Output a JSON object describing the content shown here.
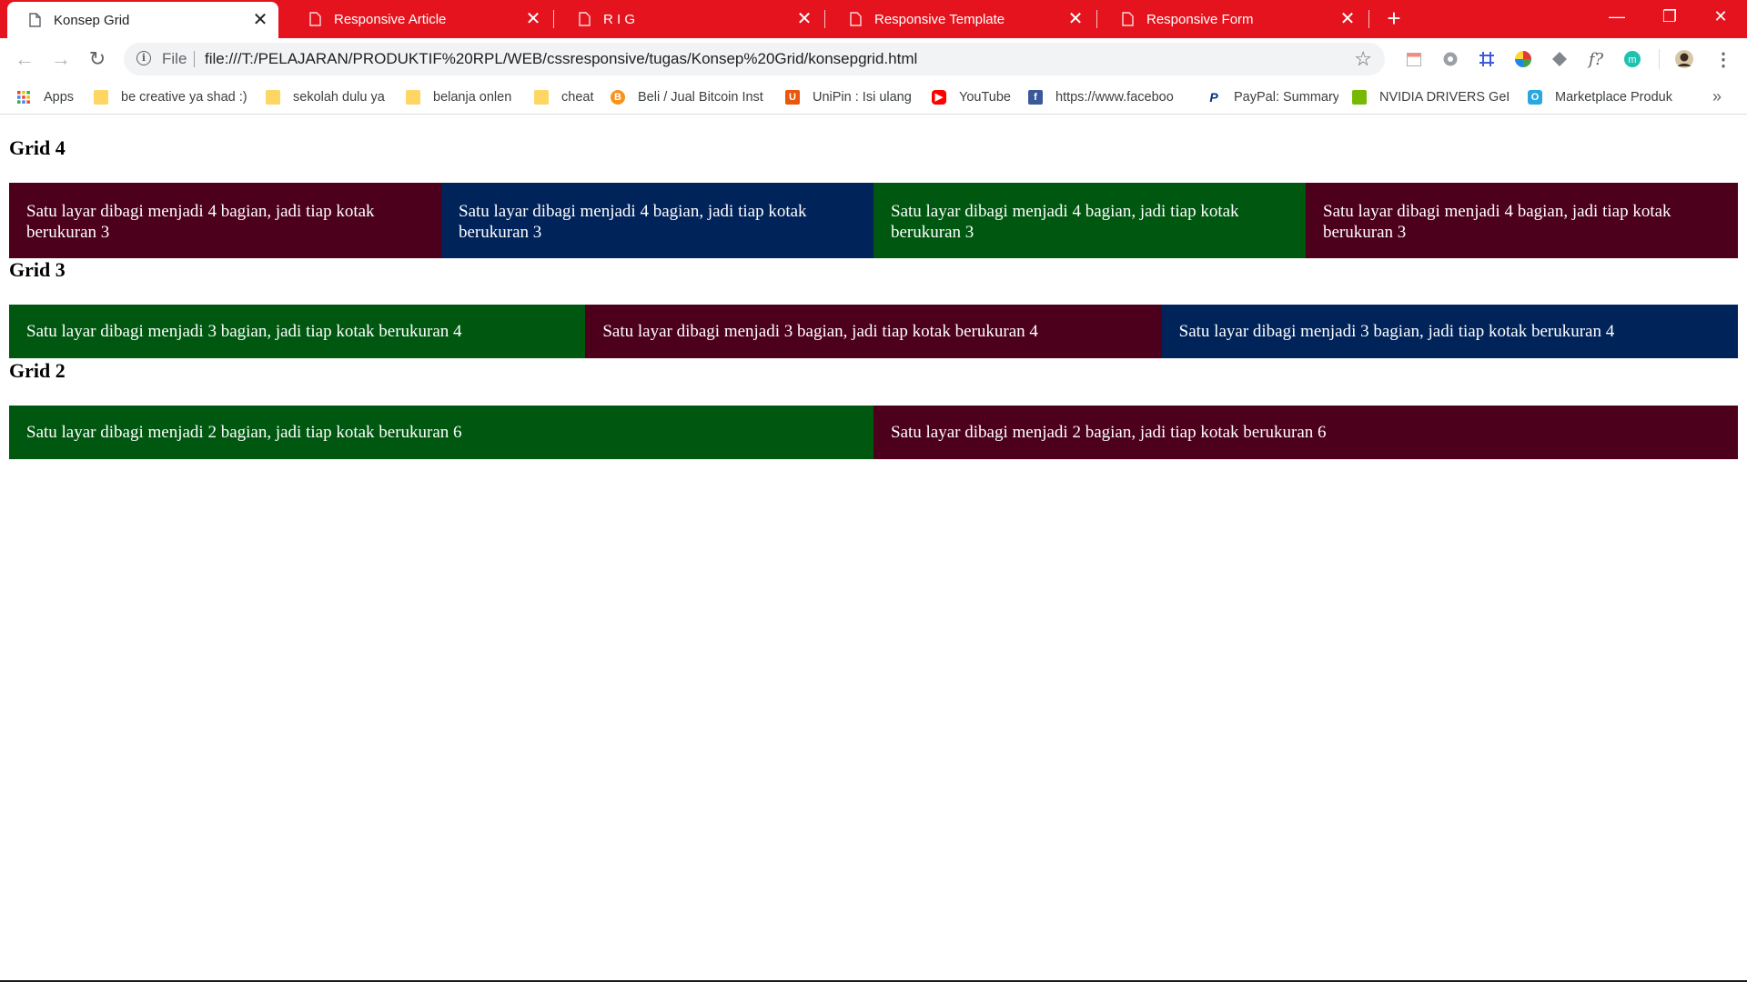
{
  "tabs": [
    {
      "label": "Konsep Grid",
      "active": true
    },
    {
      "label": "Responsive Article",
      "active": false
    },
    {
      "label": "R I G",
      "active": false
    },
    {
      "label": "Responsive Template",
      "active": false
    },
    {
      "label": "Responsive Form",
      "active": false
    }
  ],
  "omnibox": {
    "scheme_label": "File",
    "url": "file:///T:/PELAJARAN/PRODUKTIF%20RPL/WEB/cssresponsive/tugas/Konsep%20Grid/konsepgrid.html"
  },
  "bookmarks": [
    {
      "label": "Apps",
      "icon": "apps-grid-icon"
    },
    {
      "label": "be creative ya shad :)",
      "icon": "folder-icon"
    },
    {
      "label": "sekolah dulu ya",
      "icon": "folder-icon"
    },
    {
      "label": "belanja onlen",
      "icon": "folder-icon"
    },
    {
      "label": "cheat",
      "icon": "folder-icon"
    },
    {
      "label": "Beli / Jual Bitcoin Inst",
      "icon": "bitcoin-icon"
    },
    {
      "label": "UniPin : Isi ulang",
      "icon": "unipin-icon"
    },
    {
      "label": "YouTube",
      "icon": "youtube-icon"
    },
    {
      "label": "https://www.faceboo",
      "icon": "facebook-icon"
    },
    {
      "label": "PayPal: Summary",
      "icon": "paypal-icon"
    },
    {
      "label": "NVIDIA DRIVERS GeF",
      "icon": "nvidia-icon"
    },
    {
      "label": "Marketplace Produk",
      "icon": "marketplace-icon"
    }
  ],
  "colors": {
    "tabstrip": "#e4131d",
    "maroon": "#4c001b",
    "navy": "#00235a",
    "green": "#005810"
  },
  "content": {
    "grid4": {
      "heading": "Grid 4",
      "boxes": [
        {
          "text": "Satu layar dibagi menjadi 4 bagian, jadi tiap kotak berukuran 3",
          "color": "maroon"
        },
        {
          "text": "Satu layar dibagi menjadi 4 bagian, jadi tiap kotak berukuran 3",
          "color": "navy"
        },
        {
          "text": "Satu layar dibagi menjadi 4 bagian, jadi tiap kotak berukuran 3",
          "color": "green"
        },
        {
          "text": "Satu layar dibagi menjadi 4 bagian, jadi tiap kotak berukuran 3",
          "color": "maroon"
        }
      ]
    },
    "grid3": {
      "heading": "Grid 3",
      "boxes": [
        {
          "text": "Satu layar dibagi menjadi 3 bagian, jadi tiap kotak berukuran 4",
          "color": "green"
        },
        {
          "text": "Satu layar dibagi menjadi 3 bagian, jadi tiap kotak berukuran 4",
          "color": "maroon"
        },
        {
          "text": "Satu layar dibagi menjadi 3 bagian, jadi tiap kotak berukuran 4",
          "color": "navy"
        }
      ]
    },
    "grid2": {
      "heading": "Grid 2",
      "boxes": [
        {
          "text": "Satu layar dibagi menjadi 2 bagian, jadi tiap kotak berukuran 6",
          "color": "green"
        },
        {
          "text": "Satu layar dibagi menjadi 2 bagian, jadi tiap kotak berukuran 6",
          "color": "maroon"
        }
      ]
    }
  }
}
